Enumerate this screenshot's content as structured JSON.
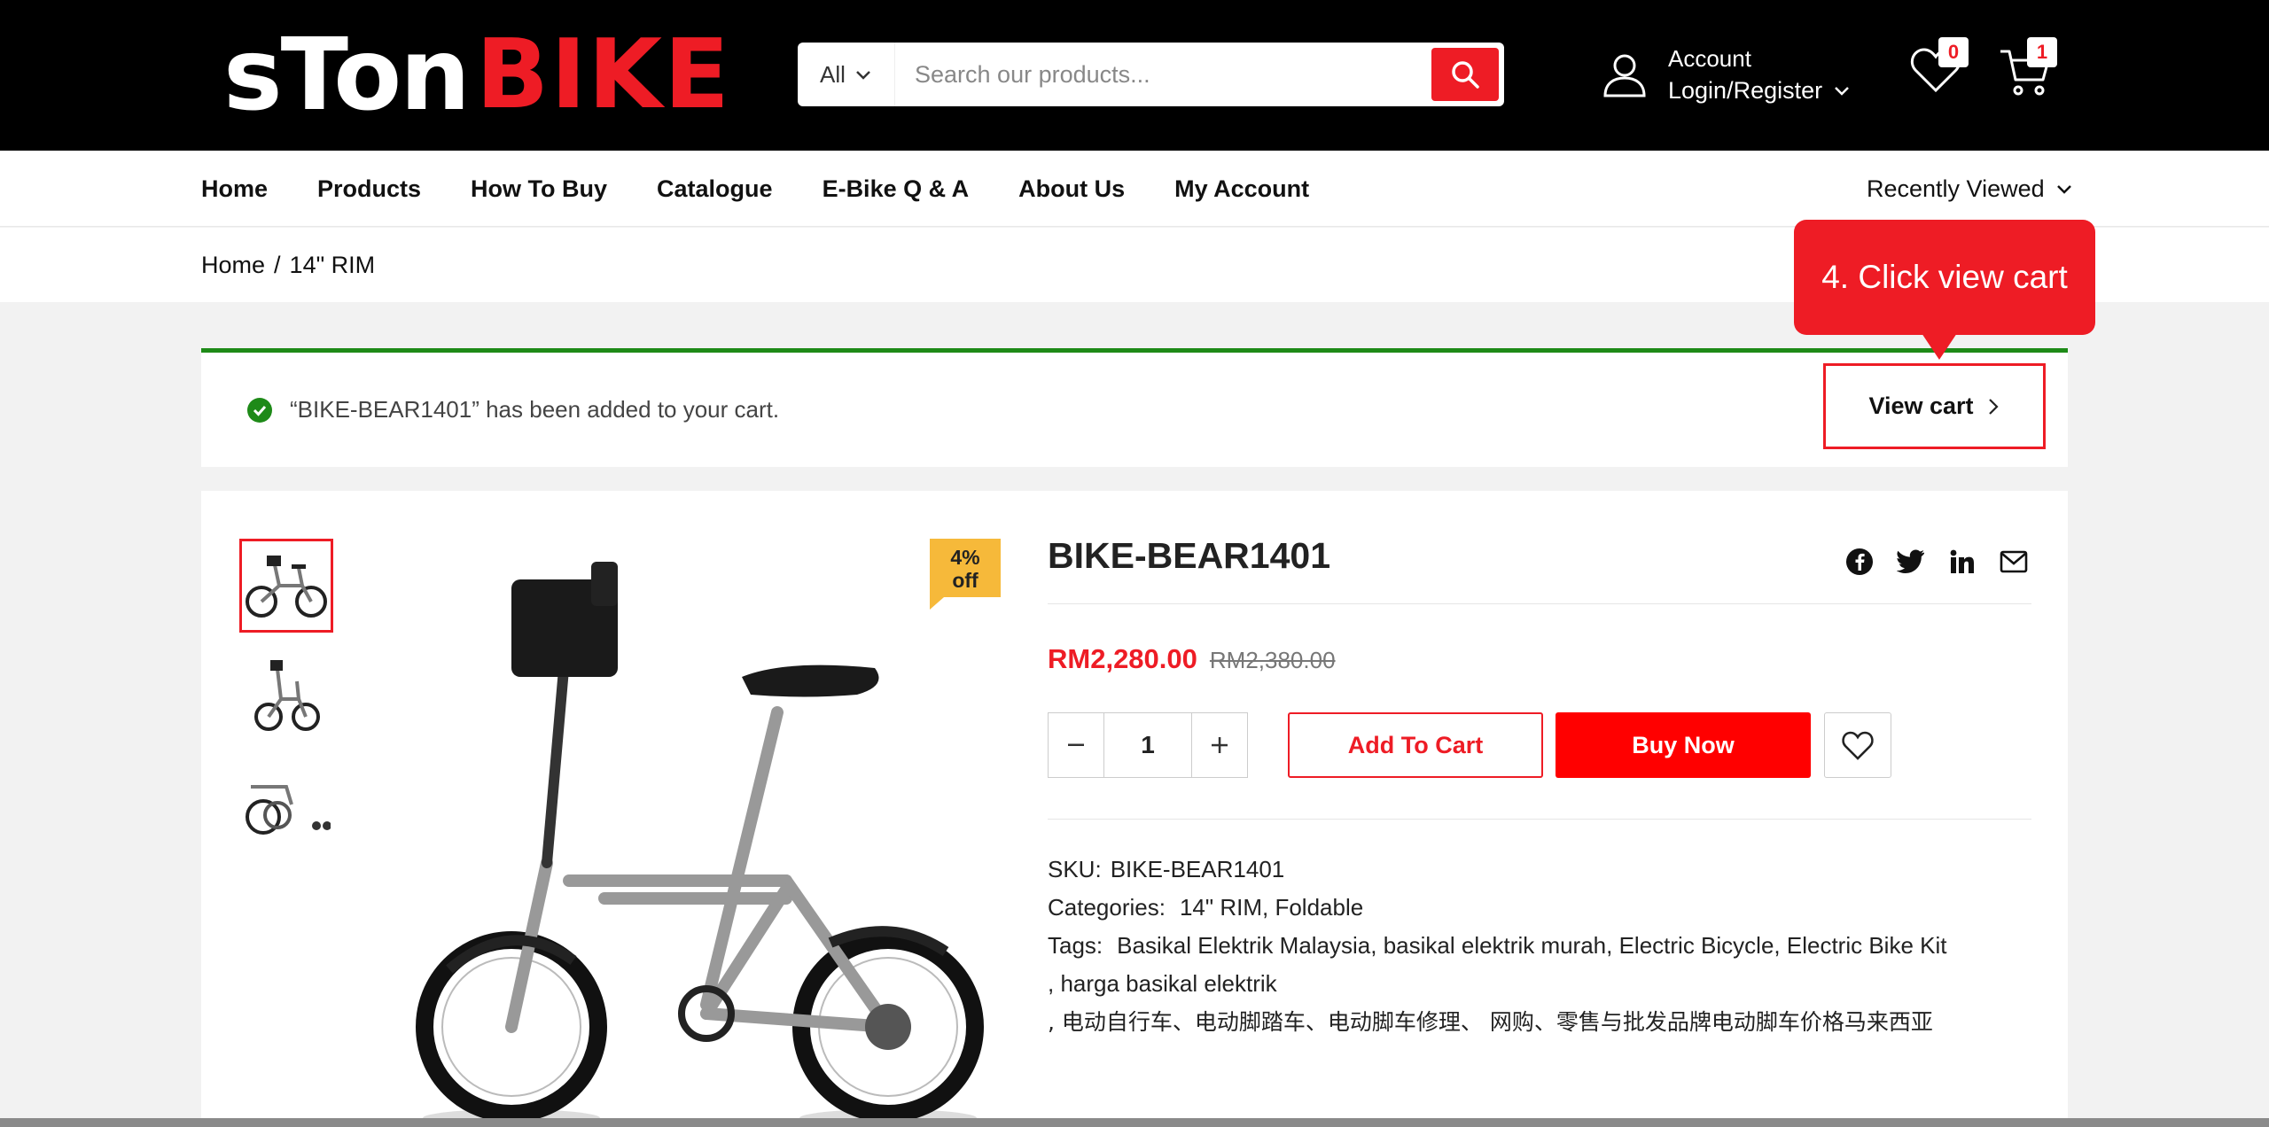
{
  "header": {
    "logo_white": "sTon",
    "logo_red": "BIKE",
    "search": {
      "category": "All",
      "placeholder": "Search our products..."
    },
    "account": {
      "label": "Account",
      "sub": "Login/Register"
    },
    "wishlist_count": "0",
    "cart_count": "1"
  },
  "nav": {
    "items": [
      "Home",
      "Products",
      "How To Buy",
      "Catalogue",
      "E-Bike Q & A",
      "About Us",
      "My Account"
    ],
    "recently_viewed": "Recently Viewed"
  },
  "breadcrumb": {
    "home": "Home",
    "sep": "/",
    "current": "14\" RIM"
  },
  "notice": {
    "message": "“BIKE-BEAR1401” has been added to your cart.",
    "view_cart": "View cart"
  },
  "callout": "4. Click view cart",
  "product": {
    "discount_line1": "4%",
    "discount_line2": "off",
    "title": "BIKE-BEAR1401",
    "price_now": "RM2,280.00",
    "price_was": "RM2,380.00",
    "quantity": "1",
    "add_to_cart": "Add To Cart",
    "buy_now": "Buy Now",
    "sku_label": "SKU:",
    "sku": "BIKE-BEAR1401",
    "categories_label": "Categories:",
    "categories": [
      "14\" RIM",
      "Foldable"
    ],
    "tags_label": "Tags:",
    "tags": [
      "Basikal Elektrik Malaysia",
      "basikal elektrik murah",
      "Electric Bicycle",
      "Electric Bike Kit"
    ],
    "tags_line2": ", harga basikal elektrik",
    "tags_line3": ", 电动自行车、电动脚踏车、电动脚车修理、 网购、零售与批发品牌电动脚车价格马来西亚"
  },
  "colors": {
    "brand_red": "#ee1c25",
    "success_green": "#1e8a18",
    "badge_orange": "#f6b93a"
  },
  "icons": [
    "user-icon",
    "heart-icon",
    "cart-icon",
    "search-icon",
    "chevron-down-icon",
    "check-circle-icon",
    "chevron-right-icon",
    "facebook-icon",
    "twitter-icon",
    "linkedin-icon",
    "mail-icon"
  ]
}
